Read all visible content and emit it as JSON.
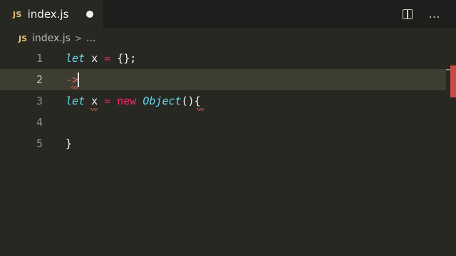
{
  "tab": {
    "icon": "JS",
    "title": "index.js"
  },
  "tab_dot": "unsaved-dot-icon",
  "actions": [
    {
      "name": "split-editor-icon",
      "label": "split-editor"
    },
    {
      "name": "more-actions-icon",
      "label": "…"
    }
  ],
  "breadcrumb": {
    "icon": "JS",
    "file": "index.js",
    "separator": ">",
    "more": "..."
  },
  "editor": {
    "lines": [
      {
        "number": "1"
      },
      {
        "number": "2"
      },
      {
        "number": "3"
      },
      {
        "number": "4"
      },
      {
        "number": "5"
      }
    ],
    "tokens": {
      "l1_kw": "let",
      "l1_var": "x",
      "l1_op": "=",
      "l1_rest": "{};",
      "l2_text": "->",
      "l3_kw": "let",
      "l3_var": "x",
      "l3_op": "=",
      "l3_new": "new",
      "l3_cls": "Object",
      "l3_paren": "()",
      "l3_brace": "{",
      "l5_brace": "}"
    }
  },
  "colors": {
    "error": "#e85d4f",
    "keyword": "#66d9ef",
    "operator": "#f92672"
  }
}
